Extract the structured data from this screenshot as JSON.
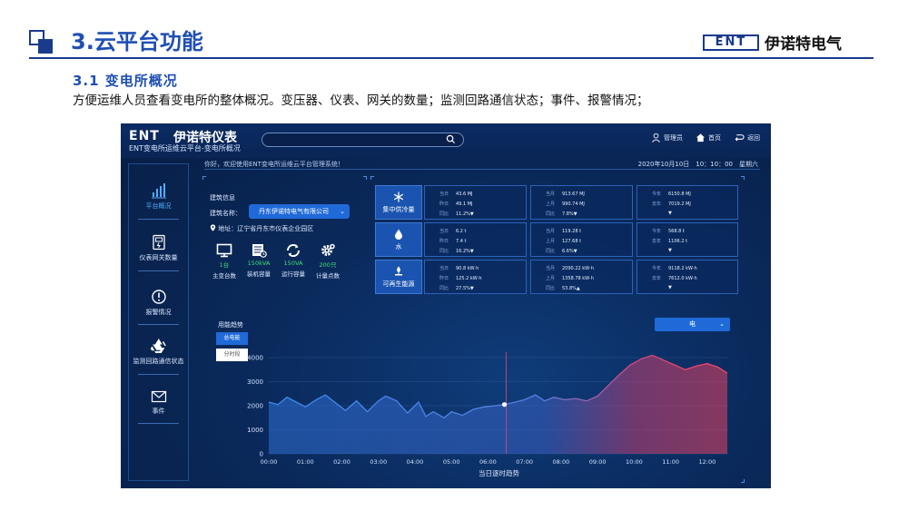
{
  "slide": {
    "title": "3.云平台功能",
    "brand_logo": "ENT",
    "brand_name": "伊诺特电气",
    "subtitle": "3.1 变电所概况",
    "description": "方便运维人员查看变电所的整体概况。变压器、仪表、网关的数量；监测回路通信状态；事件、报警情况；"
  },
  "app": {
    "logo": "ENT",
    "name": "伊诺特仪表",
    "subtitle": "ENT变电所运维云平台-变电所概况",
    "search_placeholder": "",
    "actions": [
      {
        "icon": "user-icon",
        "label": "管理员"
      },
      {
        "icon": "home-icon",
        "label": "首页"
      },
      {
        "icon": "return-icon",
        "label": "返回"
      }
    ],
    "welcome": "你好，欢迎使用ENT变电所运维云平台管理系统！",
    "datetime": "2020年10月10日　10：10：00　星期六"
  },
  "sidebar": {
    "items": [
      {
        "label": "平台概况",
        "icon": "bar-chart-icon",
        "active": true
      },
      {
        "label": "仪表网关数量",
        "icon": "meter-icon",
        "active": false
      },
      {
        "label": "报警情况",
        "icon": "alert-icon",
        "active": false
      },
      {
        "label": "监测回路通信状态",
        "icon": "recycle-icon",
        "active": false
      },
      {
        "label": "事件",
        "icon": "mail-icon",
        "active": false
      }
    ]
  },
  "building": {
    "heading": "建筑信息",
    "name_label": "建筑名称：",
    "name_value": "丹东伊诺特电气有限公司",
    "address": "地址：辽宁省丹东市仪表企业园区",
    "stats": [
      {
        "icon": "monitor-icon",
        "value": "1台",
        "label": "主变台数"
      },
      {
        "icon": "building-icon",
        "value": "150kVA",
        "label": "装机容量"
      },
      {
        "icon": "refresh-icon",
        "value": "150VA",
        "label": "运行容量"
      },
      {
        "icon": "gear-icon",
        "value": "200只",
        "label": "计量点数"
      }
    ]
  },
  "energy": [
    {
      "category": "集中供冷量",
      "icon": "snowflake-icon",
      "boxes": [
        [
          {
            "k": "当日",
            "v": "43.6 MJ"
          },
          {
            "k": "昨日",
            "v": "49.1 MJ"
          },
          {
            "k": "同比",
            "v": "11.2%▼",
            "dir": "up"
          }
        ],
        [
          {
            "k": "当月",
            "v": "913.67 MJ"
          },
          {
            "k": "上月",
            "v": "990.74 MJ"
          },
          {
            "k": "同比",
            "v": "7.8%▼",
            "dir": "up"
          }
        ],
        [
          {
            "k": "今年",
            "v": "6150.8 MJ"
          },
          {
            "k": "去年",
            "v": "7019.2 MJ"
          },
          {
            "k": "",
            "v": "▼",
            "dir": "up"
          }
        ]
      ]
    },
    {
      "category": "水",
      "icon": "water-drop-icon",
      "boxes": [
        [
          {
            "k": "当日",
            "v": "6.2 t"
          },
          {
            "k": "昨日",
            "v": "7.4 t"
          },
          {
            "k": "同比",
            "v": "16.2%▼",
            "dir": "up"
          }
        ],
        [
          {
            "k": "当月",
            "v": "119.28 t"
          },
          {
            "k": "上月",
            "v": "127.68 t"
          },
          {
            "k": "同比",
            "v": "6.6%▼",
            "dir": "up"
          }
        ],
        [
          {
            "k": "今年",
            "v": "568.8 t"
          },
          {
            "k": "去年",
            "v": "1106.2 t"
          },
          {
            "k": "",
            "v": "▼",
            "dir": "up"
          }
        ]
      ]
    },
    {
      "category": "可再生能源",
      "icon": "renewable-icon",
      "boxes": [
        [
          {
            "k": "当日",
            "v": "90.8 kW·h"
          },
          {
            "k": "昨日",
            "v": "125.2 kW·h"
          },
          {
            "k": "同比",
            "v": "27.5%▼",
            "dir": "up"
          }
        ],
        [
          {
            "k": "当月",
            "v": "2090.22 kW·h"
          },
          {
            "k": "上月",
            "v": "1358.78 kW·h"
          },
          {
            "k": "同比",
            "v": "53.8%▲",
            "dir": "down"
          }
        ],
        [
          {
            "k": "今年",
            "v": "9118.2 kW·h"
          },
          {
            "k": "去年",
            "v": "7612.0 kW·h"
          },
          {
            "k": "",
            "v": "▼",
            "dir": "up"
          }
        ]
      ]
    }
  ],
  "trend": {
    "title": "用能趋势",
    "btn_total": "总电能",
    "btn_period": "分时段",
    "selector": "电",
    "xlabel": "当日逐时趋势"
  },
  "chart_data": {
    "type": "area",
    "xlabel": "当日逐时趋势",
    "x_ticks": [
      "00:00",
      "01:00",
      "02:00",
      "03:00",
      "04:00",
      "05:00",
      "06:00",
      "07:00",
      "08:00",
      "09:00",
      "10:00",
      "11:00",
      "12:00"
    ],
    "y_ticks": [
      0,
      1000,
      2000,
      3000,
      4000
    ],
    "ylim": [
      0,
      4000
    ],
    "xlim": [
      0,
      12.6
    ],
    "x": [
      0,
      0.25,
      0.5,
      0.75,
      1.0,
      1.3,
      1.55,
      1.8,
      2.1,
      2.4,
      2.7,
      3.0,
      3.2,
      3.5,
      3.8,
      4.1,
      4.3,
      4.5,
      4.8,
      5.0,
      5.3,
      5.6,
      5.9,
      6.2,
      6.45,
      6.75,
      7.0,
      7.3,
      7.55,
      7.8,
      8.1,
      8.4,
      8.7,
      9.0,
      9.3,
      9.6,
      9.9,
      10.2,
      10.5,
      10.8,
      11.1,
      11.4,
      11.7,
      12.0,
      12.3,
      12.55
    ],
    "values": [
      2150,
      2050,
      2350,
      2150,
      1950,
      2250,
      2450,
      2150,
      1800,
      2200,
      1750,
      2200,
      2400,
      2200,
      1700,
      2150,
      1550,
      1750,
      1500,
      1750,
      1600,
      1850,
      1950,
      2000,
      2050,
      2150,
      2250,
      2450,
      2200,
      2350,
      2250,
      2300,
      2200,
      2400,
      2850,
      3300,
      3700,
      3950,
      4100,
      3900,
      3700,
      3500,
      3650,
      3750,
      3600,
      3350
    ],
    "marker_x": 6.45,
    "marker_line_x": 6.5
  }
}
